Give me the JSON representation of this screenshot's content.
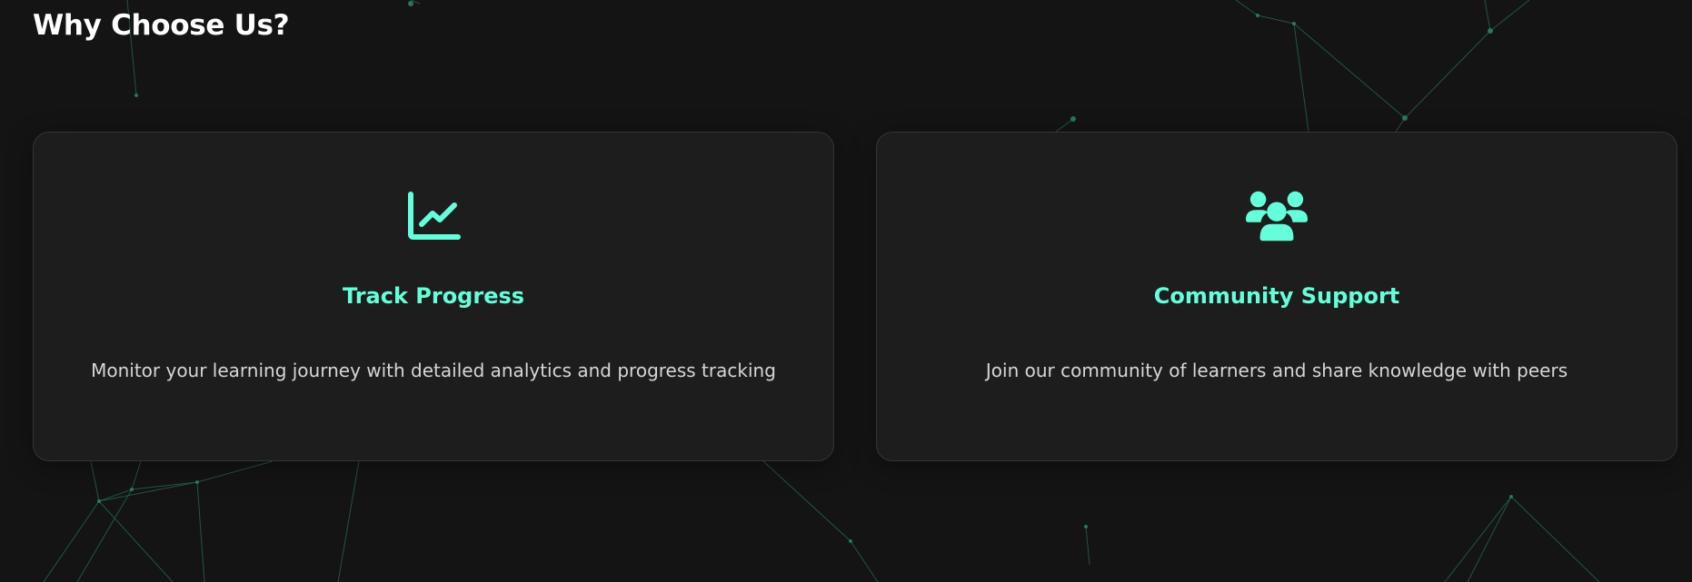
{
  "section": {
    "title": "Why Choose Us?"
  },
  "features": [
    {
      "icon": "chart-line-icon",
      "title": "Track Progress",
      "description": "Monitor your learning journey with detailed analytics and progress tracking"
    },
    {
      "icon": "users-icon",
      "title": "Community Support",
      "description": "Join our community of learners and share knowledge with peers"
    }
  ],
  "colors": {
    "background": "#141414",
    "card_background": "#1e1e1e",
    "card_border": "#343434",
    "accent": "#64ffda",
    "heading": "#ffffff",
    "body_text": "#d6d6d6",
    "network_lines": "#2e8b6d"
  }
}
